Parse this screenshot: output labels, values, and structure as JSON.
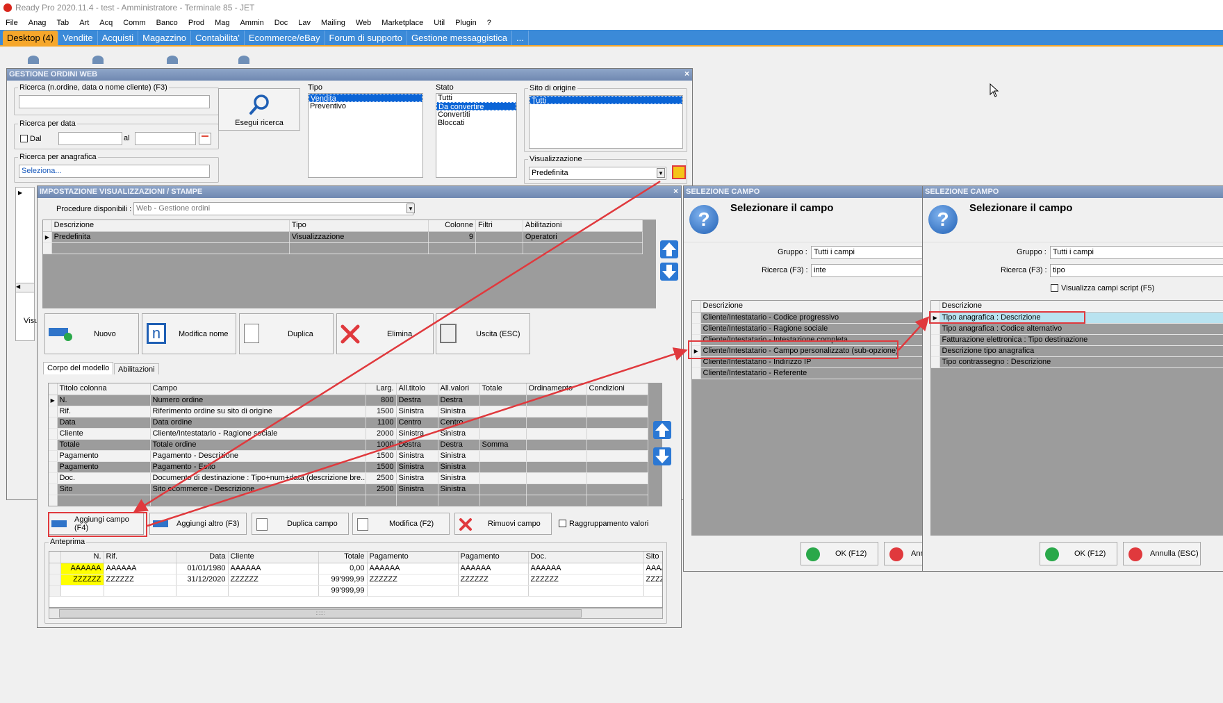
{
  "app": {
    "title": "Ready Pro 2020.11.4 - test - Amministratore - Terminale 85 - JET"
  },
  "menu": [
    "File",
    "Anag",
    "Tab",
    "Art",
    "Acq",
    "Comm",
    "Banco",
    "Prod",
    "Mag",
    "Ammin",
    "Doc",
    "Lav",
    "Mailing",
    "Web",
    "Marketplace",
    "Util",
    "Plugin",
    "?"
  ],
  "tabs": [
    "Desktop (4)",
    "Vendite",
    "Acquisti",
    "Magazzino",
    "Contabilita'",
    "Ecommerce/eBay",
    "Forum di supporto",
    "Gestione messaggistica",
    "..."
  ],
  "ordini": {
    "title": "GESTIONE ORDINI WEB",
    "search_label": "Ricerca (n.ordine, data o nome cliente) (F3)",
    "search_value": "",
    "run_search": "Esegui ricerca",
    "date_label": "Ricerca per data",
    "dal": "Dal",
    "al": "al",
    "anag_label": "Ricerca per anagrafica",
    "anag_value": "Seleziona...",
    "tipo_label": "Tipo",
    "tipo_items": [
      "Vendita",
      "Preventivo"
    ],
    "stato_label": "Stato",
    "stato_items": [
      "Tutti",
      "Da convertire",
      "Convertiti",
      "Bloccati"
    ],
    "sito_label": "Sito di origine",
    "sito_items": [
      "Tutti"
    ],
    "vis_label": "Visualizzazione",
    "vis_value": "Predefinita",
    "partial_label": "Visu"
  },
  "imp": {
    "title": "IMPOSTAZIONE VISUALIZZAZIONI / STAMPE",
    "proc_label": "Procedure disponibili :",
    "proc_value": "Web - Gestione ordini",
    "models_headers": [
      "Descrizione",
      "Tipo",
      "Colonne",
      "Filtri",
      "Abilitazioni"
    ],
    "models_rows": [
      [
        "Predefinita",
        "Visualizzazione",
        "9",
        "",
        "Operatori"
      ]
    ],
    "buttons": [
      "Nuovo",
      "Modifica nome",
      "Duplica",
      "Elimina",
      "Uscita (ESC)"
    ],
    "subtabs": [
      "Corpo del modello",
      "Abilitazioni"
    ],
    "cols_headers": [
      "Titolo colonna",
      "Campo",
      "Larg.",
      "All.titolo",
      "All.valori",
      "Totale",
      "Ordinamento",
      "Condizioni"
    ],
    "cols_rows": [
      [
        "N.",
        "Numero ordine",
        "800",
        "Destra",
        "Destra",
        "",
        "",
        ""
      ],
      [
        "Rif.",
        "Riferimento ordine su sito di origine",
        "1500",
        "Sinistra",
        "Sinistra",
        "",
        "",
        ""
      ],
      [
        "Data",
        "Data ordine",
        "1100",
        "Centro",
        "Centro",
        "",
        "",
        ""
      ],
      [
        "Cliente",
        "Cliente/Intestatario - Ragione sociale",
        "2000",
        "Sinistra",
        "Sinistra",
        "",
        "",
        ""
      ],
      [
        "Totale",
        "Totale ordine",
        "1000",
        "Destra",
        "Destra",
        "Somma",
        "",
        ""
      ],
      [
        "Pagamento",
        "Pagamento - Descrizione",
        "1500",
        "Sinistra",
        "Sinistra",
        "",
        "",
        ""
      ],
      [
        "Pagamento",
        "Pagamento - Esito",
        "1500",
        "Sinistra",
        "Sinistra",
        "",
        "",
        ""
      ],
      [
        "Doc.",
        "Documento di destinazione : Tipo+num+data (descrizione bre...",
        "2500",
        "Sinistra",
        "Sinistra",
        "",
        "",
        ""
      ],
      [
        "Sito",
        "Sito ecommerce - Descrizione",
        "2500",
        "Sinistra",
        "Sinistra",
        "",
        "",
        ""
      ]
    ],
    "field_buttons": [
      "Aggiungi campo (F4)",
      "Aggiungi altro (F3)",
      "Duplica campo",
      "Modifica (F2)",
      "Rimuovi campo"
    ],
    "group_values": "Raggruppamento valori",
    "preview_label": "Anteprima",
    "preview_headers": [
      "N.",
      "Rif.",
      "Data",
      "Cliente",
      "Totale",
      "Pagamento",
      "Pagamento",
      "Doc.",
      "Sito"
    ],
    "preview_rows": [
      [
        "AAAAAA",
        "AAAAAA",
        "01/01/1980",
        "AAAAAA",
        "0,00",
        "AAAAAA",
        "AAAAAA",
        "AAAAAA",
        "AAAAAA"
      ],
      [
        "ZZZZZZ",
        "ZZZZZZ",
        "31/12/2020",
        "ZZZZZZ",
        "99'999,99",
        "ZZZZZZ",
        "ZZZZZZ",
        "ZZZZZZ",
        "ZZZZZZ"
      ],
      [
        "",
        "",
        "",
        "",
        "99'999,99",
        "",
        "",
        "",
        ""
      ]
    ],
    "scroll_grip": "::::::"
  },
  "sel1": {
    "title": "SELEZIONE CAMPO",
    "heading": "Selezionare il campo",
    "gruppo_label": "Gruppo :",
    "gruppo_value": "Tutti i campi",
    "ricerca_label": "Ricerca (F3) :",
    "ricerca_value": "inte",
    "col": "Descrizione",
    "items": [
      "Cliente/Intestatario - Codice progressivo",
      "Cliente/Intestatario - Ragione sociale",
      "Cliente/Intestatario - Intestazione completa",
      "Cliente/Intestatario - Campo personalizzato (sub-opzione)",
      "Cliente/Intestatario - Indirizzo IP",
      "Cliente/Intestatario - Referente"
    ],
    "ok": "OK (F12)",
    "cancel": "Annulla (ESC)"
  },
  "sel2": {
    "title": "SELEZIONE CAMPO",
    "heading": "Selezionare il campo",
    "gruppo_label": "Gruppo :",
    "gruppo_value": "Tutti i campi",
    "ricerca_label": "Ricerca (F3) :",
    "ricerca_value": "tipo",
    "script_label": "Visualizza campi script (F5)",
    "col": "Descrizione",
    "items": [
      "Tipo anagrafica : Descrizione",
      "Tipo anagrafica : Codice alternativo",
      "Fatturazione elettronica : Tipo destinazione",
      "Descrizione tipo anagrafica",
      "Tipo contrassegno : Descrizione"
    ],
    "ok": "OK (F12)",
    "cancel": "Annulla (ESC)"
  },
  "colors": {
    "accent": "#3b8ad8",
    "active_tab": "#f6a72b",
    "highlight": "#e0393d",
    "selection": "#0a64d6",
    "preview_yellow": "#ffff00"
  }
}
